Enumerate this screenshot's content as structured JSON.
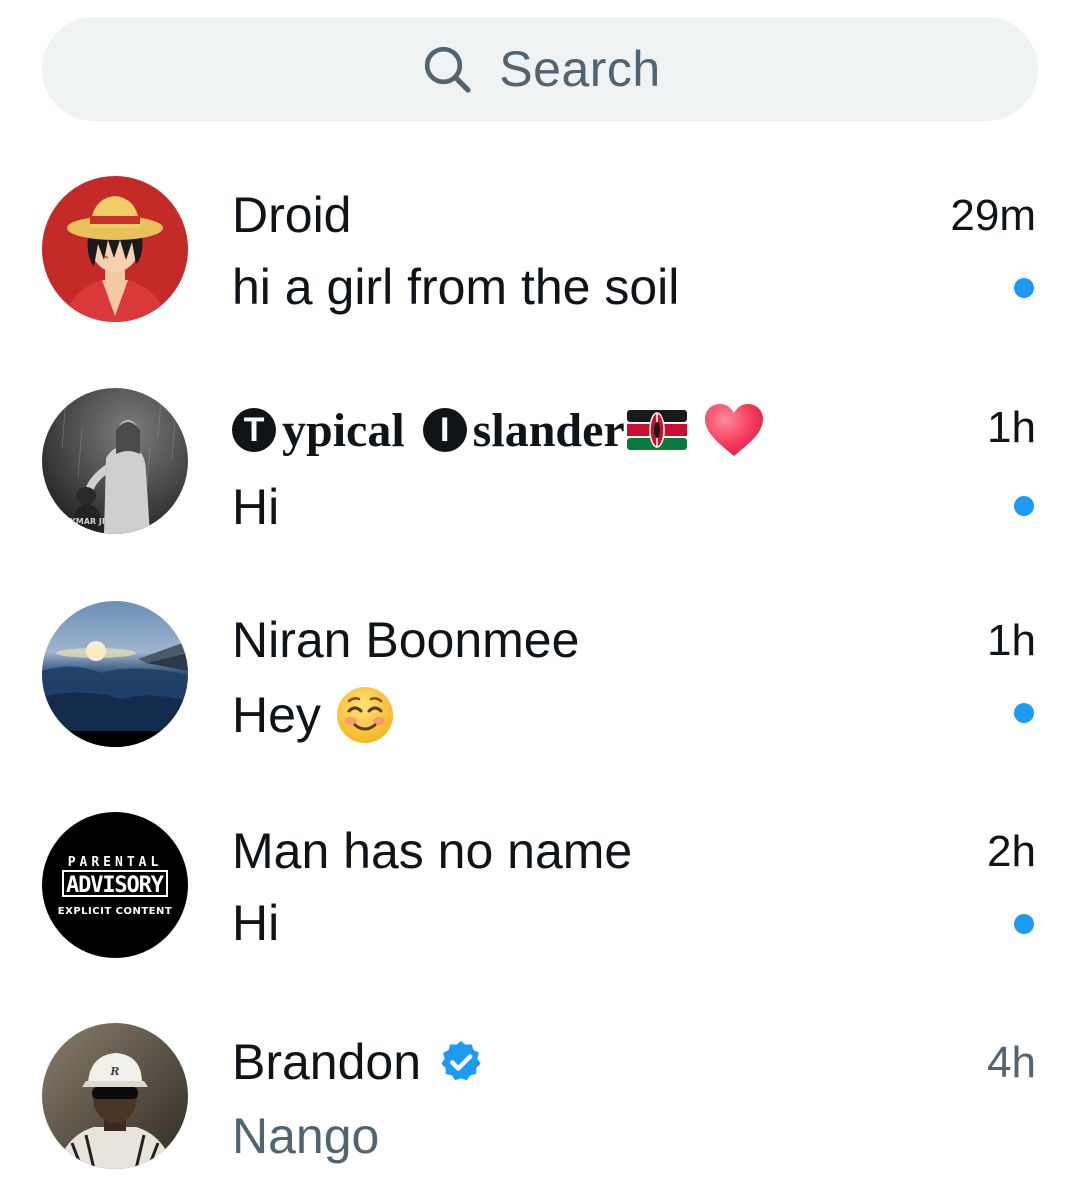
{
  "search": {
    "placeholder": "Search"
  },
  "conversations": [
    {
      "name": "Droid",
      "preview": "hi a girl from the soil",
      "time": "29m",
      "unread": true,
      "avatar_icon": "anime-straw-hat-avatar"
    },
    {
      "name_parts": [
        "ypical",
        "slander"
      ],
      "name_initials": [
        "T",
        "I"
      ],
      "name": "🅣ypical 🅘slander🇰🇪❤️",
      "preview": "Hi",
      "time": "1h",
      "unread": true,
      "avatar_icon": "jesus-rain-avatar",
      "name_emojis": [
        "kenya-flag-icon",
        "heart-icon"
      ]
    },
    {
      "name": "Niran Boonmee",
      "preview": "Hey",
      "preview_emoji": "smiling-face-icon",
      "time": "1h",
      "unread": true,
      "avatar_icon": "airplane-window-sky-avatar"
    },
    {
      "name": "Man has no name",
      "preview": "Hi",
      "time": "2h",
      "unread": true,
      "avatar_icon": "parental-advisory-avatar",
      "avatar_text": {
        "line1": "PARENTAL",
        "line2": "ADVISORY",
        "line3": "EXPLICIT CONTENT"
      }
    },
    {
      "name": "Brandon",
      "preview": "Nango",
      "time": "4h",
      "unread": false,
      "verified": true,
      "avatar_icon": "man-cap-sunglasses-avatar"
    }
  ],
  "colors": {
    "accent": "#1d9bf0",
    "text_primary": "#0f1419",
    "text_secondary": "#536471",
    "search_bg": "#eff3f4"
  }
}
